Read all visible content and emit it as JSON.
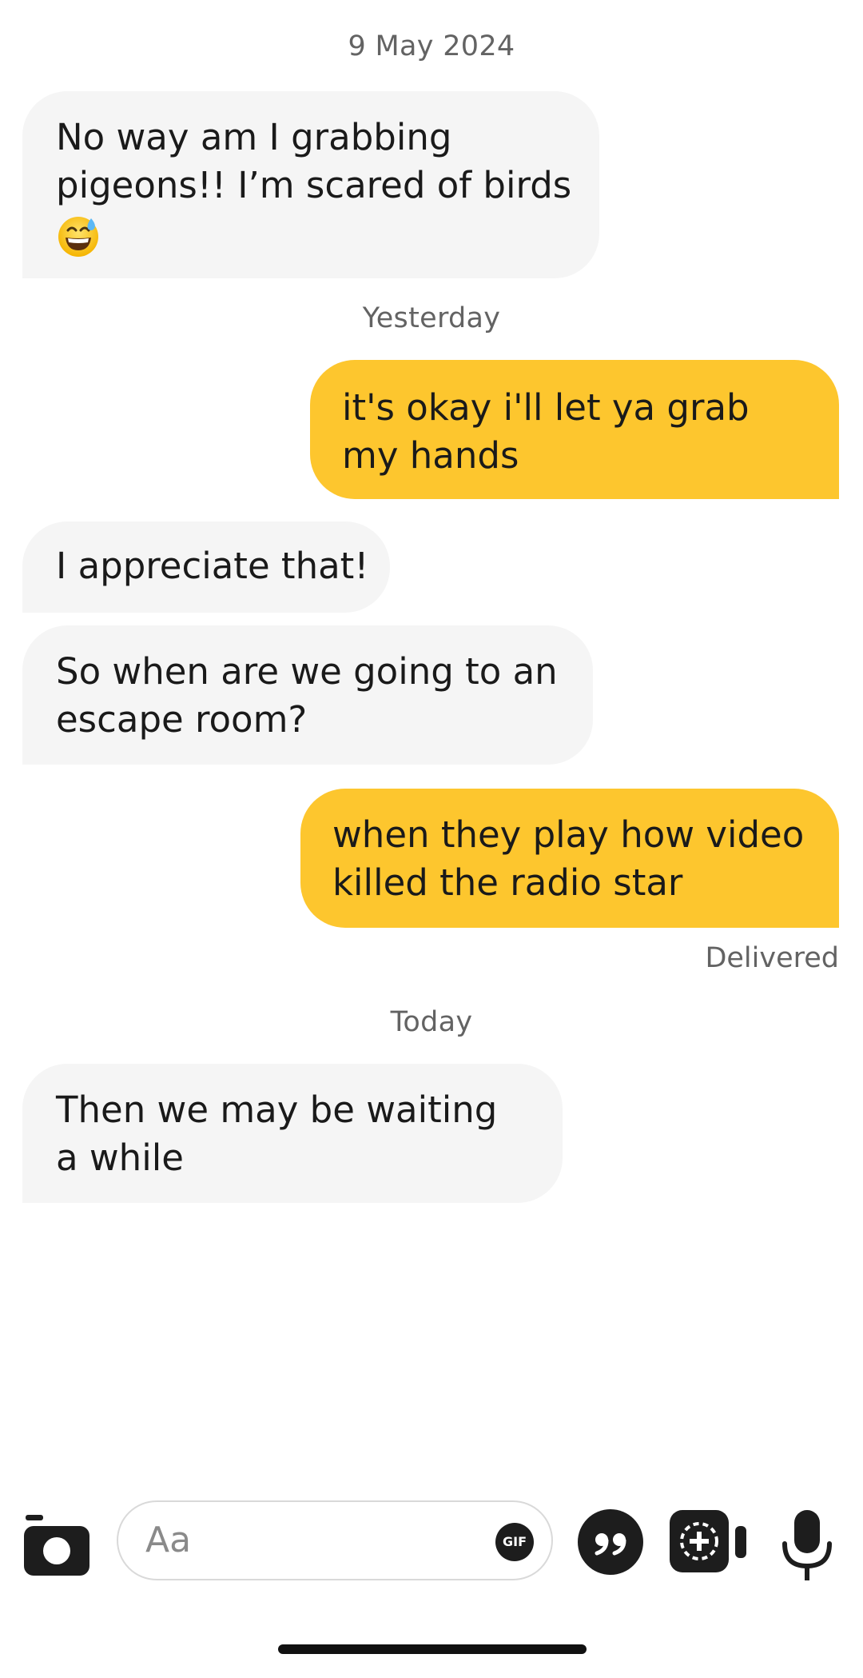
{
  "thread": {
    "date_header": "9 May 2024",
    "msg1": {
      "line1": "No way am I grabbing",
      "line2": "pigeons!! I’m scared of birds",
      "emoji": "sweat-smile-emoji"
    },
    "yesterday_label": "Yesterday",
    "msg2": {
      "line1": "it's okay i'll let ya grab",
      "line2": "my hands"
    },
    "msg3": {
      "line1": "I appreciate that!"
    },
    "msg4": {
      "line1": "So when are we going to an",
      "line2": "escape room?"
    },
    "msg5": {
      "line1": "when they play how video",
      "line2": "killed the radio star"
    },
    "delivered_label": "Delivered",
    "today_label": "Today",
    "msg6": {
      "line1": "Then we may be waiting",
      "line2": "a while"
    }
  },
  "composer": {
    "placeholder": "Aa",
    "gif_label": "GIF",
    "icons": [
      "camera-icon",
      "gif-icon",
      "quote-icon",
      "video-call-icon",
      "microphone-icon"
    ]
  },
  "colors": {
    "outgoing_bubble": "#fdc62e",
    "incoming_bubble": "#f5f5f5",
    "timestamp_text": "#636363"
  }
}
